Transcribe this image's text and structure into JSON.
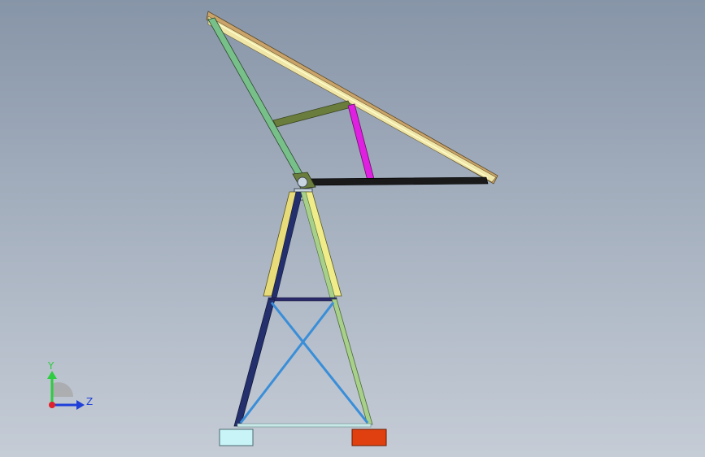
{
  "viewport": {
    "background_top": "#8795a8",
    "background_bottom": "#c5ccd6"
  },
  "triad": {
    "y_label": "Y",
    "z_label": "Z",
    "colors": {
      "y": "#2ecc40",
      "z": "#1f3fd8",
      "x": "#e0202a"
    }
  },
  "model": {
    "colors": {
      "panel_frame": "#f0e6a8",
      "panel_edge": "#c9a36a",
      "diagonal_strut": "#78c08a",
      "cross_strut": "#6b7d3c",
      "brace_magenta": "#e020e0",
      "base_beam": "#1a1a1a",
      "upper_leg_left": "#e8dc7a",
      "upper_leg_right": "#f0ec8a",
      "leg_left": "#24306e",
      "leg_right": "#a8d08a",
      "x_brace": "#3a8ed8",
      "tie_bar": "#2a2a6a",
      "foot_left": "#c8f4f8",
      "foot_right": "#e04010",
      "bottom_tie": "#c8e8e8",
      "hub": "#c8d4e0"
    }
  }
}
